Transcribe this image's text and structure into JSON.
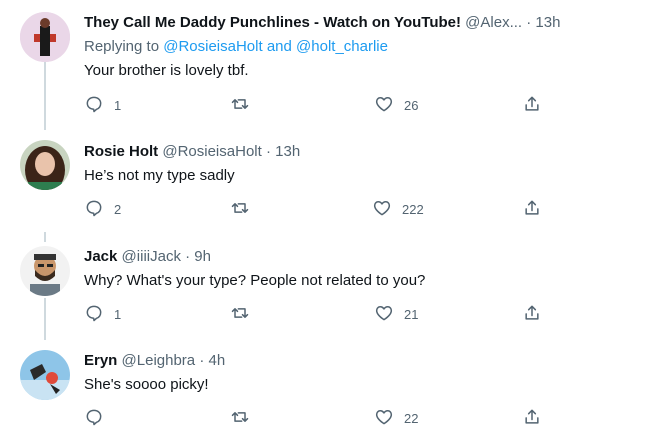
{
  "tweets": [
    {
      "name": "They Call Me Daddy Punchlines - Watch on YouTube!",
      "handle": "@Alex...",
      "time": "13h",
      "replying_prefix": "Replying to",
      "replying_user1": "@RosieisaHolt",
      "replying_and": "and",
      "replying_user2": "@holt_charlie",
      "text": "Your brother is lovely tbf.",
      "replies": "1",
      "retweets": "",
      "likes": "26"
    },
    {
      "name": "Rosie Holt",
      "handle": "@RosieisaHolt",
      "time": "13h",
      "text": "He’s not my type sadly",
      "replies": "2",
      "retweets": "",
      "likes": "222"
    },
    {
      "name": "Jack",
      "handle": "@iiiiJack",
      "time": "9h",
      "text": "Why? What's your type? People not related to you?",
      "replies": "1",
      "retweets": "",
      "likes": "21"
    },
    {
      "name": "Eryn",
      "handle": "@Leighbra",
      "time": "4h",
      "text": "She's soooo picky!",
      "replies": "",
      "retweets": "",
      "likes": "22"
    }
  ],
  "separator": "·",
  "colors": {
    "text": "#0f1419",
    "secondary": "#536471",
    "link": "#1d9bf0",
    "thread_line": "#cfd9de"
  },
  "icons": [
    "reply-icon",
    "retweet-icon",
    "like-icon",
    "share-icon"
  ]
}
